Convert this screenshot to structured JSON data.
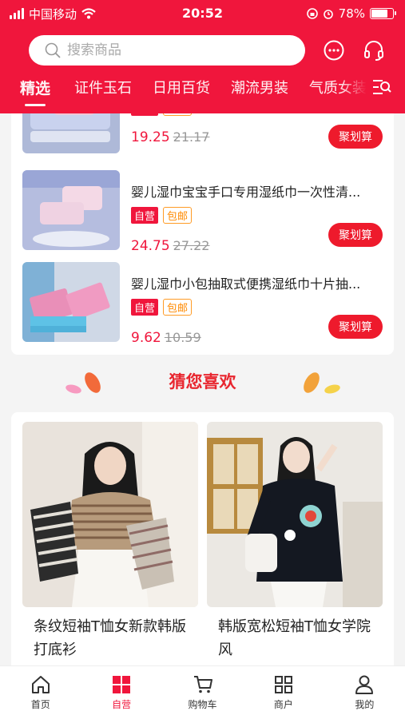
{
  "status_bar": {
    "carrier": "中国移动",
    "time": "20:52",
    "battery": "78%",
    "battery_level": 0.78
  },
  "search": {
    "placeholder": "搜索商品"
  },
  "tabs": [
    "精选",
    "证件玉石",
    "日用百货",
    "潮流男装",
    "气质女装"
  ],
  "products": [
    {
      "title": "",
      "badge_self": "自营",
      "badge_ship": "包邮",
      "price": "19.25",
      "old_price": "21.17",
      "button": "聚划算"
    },
    {
      "title": "婴儿湿巾宝宝手口专用湿纸巾一次性清...",
      "badge_self": "自营",
      "badge_ship": "包邮",
      "price": "24.75",
      "old_price": "27.22",
      "button": "聚划算"
    },
    {
      "title": "婴儿湿巾小包抽取式便携湿纸巾十片抽...",
      "badge_self": "自营",
      "badge_ship": "包邮",
      "price": "9.62",
      "old_price": "10.59",
      "button": "聚划算"
    }
  ],
  "guess": {
    "title": "猜您喜欢",
    "items": [
      {
        "name": "条纹短袖T恤女新款韩版打底衫"
      },
      {
        "name": "韩版宽松短袖T恤女学院风"
      }
    ]
  },
  "nav": [
    {
      "label": "首页",
      "icon": "home-icon"
    },
    {
      "label": "自营",
      "icon": "grid-icon"
    },
    {
      "label": "购物车",
      "icon": "cart-icon"
    },
    {
      "label": "商户",
      "icon": "store-grid-icon"
    },
    {
      "label": "我的",
      "icon": "user-icon"
    }
  ],
  "colors": {
    "brand": "#f0163c",
    "deal_button": "#ee1a2c",
    "ship_badge": "#ff8a00"
  }
}
